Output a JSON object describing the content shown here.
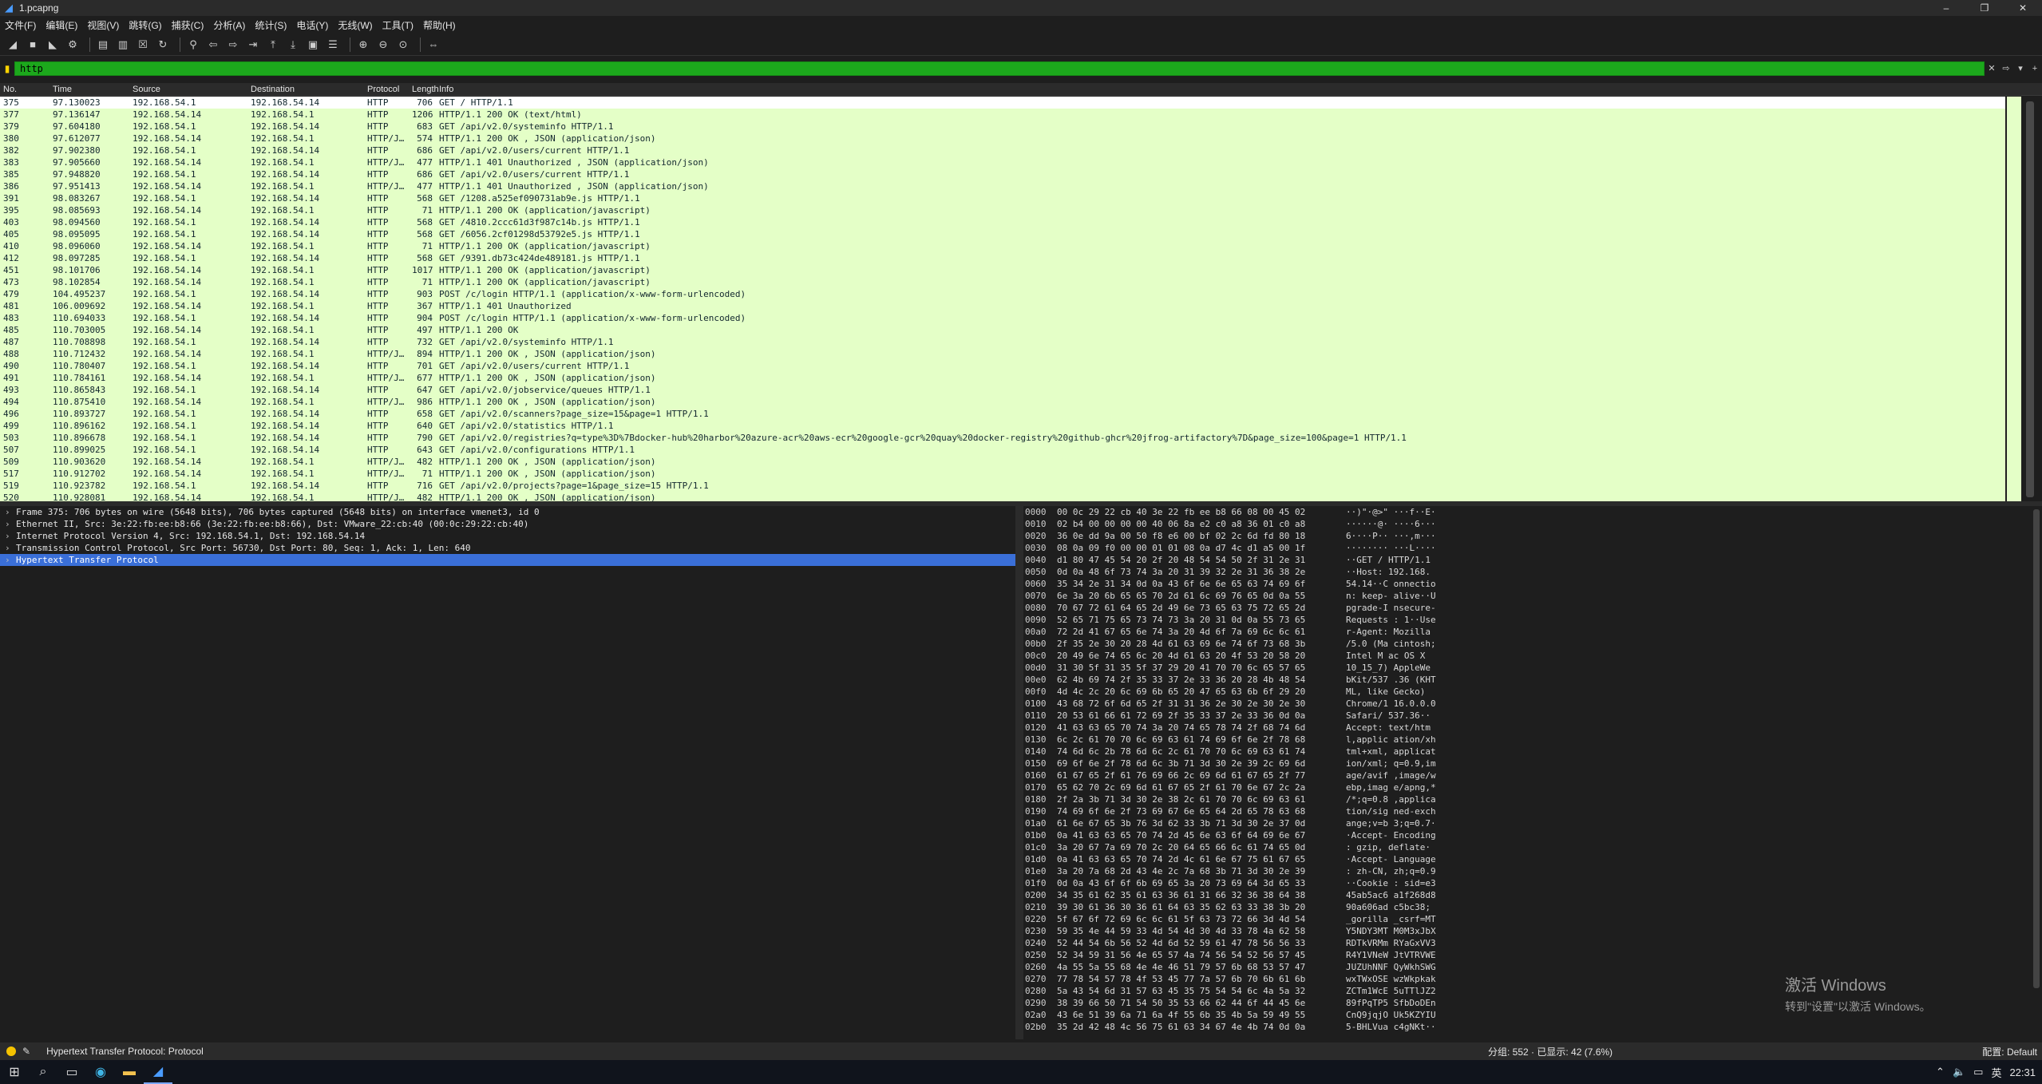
{
  "window": {
    "title": "1.pcapng",
    "minimize": "–",
    "maximize": "❐",
    "close": "✕"
  },
  "menu": [
    "文件(F)",
    "编辑(E)",
    "视图(V)",
    "跳转(G)",
    "捕获(C)",
    "分析(A)",
    "统计(S)",
    "电话(Y)",
    "无线(W)",
    "工具(T)",
    "帮助(H)"
  ],
  "toolbar_icons": [
    "shark-fin-icon",
    "stop-icon",
    "restart-icon",
    "gear-icon",
    "open-file-icon",
    "save-file-icon",
    "close-file-icon",
    "reload-icon",
    "find-icon",
    "back-icon",
    "forward-icon",
    "go-to-icon",
    "first-icon",
    "last-icon",
    "autoscroll-icon",
    "colorize-icon",
    "zoom-in-icon",
    "zoom-out-icon",
    "zoom-reset-icon",
    "resize-columns-icon"
  ],
  "filter": {
    "value": "http",
    "clear": "✕",
    "arrow": "⇨",
    "add": "+"
  },
  "columns": [
    "No.",
    "Time",
    "Source",
    "Destination",
    "Protocol",
    "Length",
    "Info"
  ],
  "packets": [
    {
      "no": "375",
      "time": "97.130023",
      "src": "192.168.54.1",
      "dst": "192.168.54.14",
      "proto": "HTTP",
      "len": "706",
      "info": "GET / HTTP/1.1",
      "sel": true
    },
    {
      "no": "377",
      "time": "97.136147",
      "src": "192.168.54.14",
      "dst": "192.168.54.1",
      "proto": "HTTP",
      "len": "1206",
      "info": "HTTP/1.1 200 OK  (text/html)"
    },
    {
      "no": "379",
      "time": "97.604180",
      "src": "192.168.54.1",
      "dst": "192.168.54.14",
      "proto": "HTTP",
      "len": "683",
      "info": "GET /api/v2.0/systeminfo HTTP/1.1"
    },
    {
      "no": "380",
      "time": "97.612077",
      "src": "192.168.54.14",
      "dst": "192.168.54.1",
      "proto": "HTTP/J…",
      "len": "574",
      "info": "HTTP/1.1 200 OK , JSON (application/json)"
    },
    {
      "no": "382",
      "time": "97.902380",
      "src": "192.168.54.1",
      "dst": "192.168.54.14",
      "proto": "HTTP",
      "len": "686",
      "info": "GET /api/v2.0/users/current HTTP/1.1"
    },
    {
      "no": "383",
      "time": "97.905660",
      "src": "192.168.54.14",
      "dst": "192.168.54.1",
      "proto": "HTTP/J…",
      "len": "477",
      "info": "HTTP/1.1 401 Unauthorized , JSON (application/json)"
    },
    {
      "no": "385",
      "time": "97.948820",
      "src": "192.168.54.1",
      "dst": "192.168.54.14",
      "proto": "HTTP",
      "len": "686",
      "info": "GET /api/v2.0/users/current HTTP/1.1"
    },
    {
      "no": "386",
      "time": "97.951413",
      "src": "192.168.54.14",
      "dst": "192.168.54.1",
      "proto": "HTTP/J…",
      "len": "477",
      "info": "HTTP/1.1 401 Unauthorized , JSON (application/json)"
    },
    {
      "no": "391",
      "time": "98.083267",
      "src": "192.168.54.1",
      "dst": "192.168.54.14",
      "proto": "HTTP",
      "len": "568",
      "info": "GET /1208.a525ef090731ab9e.js HTTP/1.1"
    },
    {
      "no": "395",
      "time": "98.085693",
      "src": "192.168.54.14",
      "dst": "192.168.54.1",
      "proto": "HTTP",
      "len": "71",
      "info": "HTTP/1.1 200 OK  (application/javascript)"
    },
    {
      "no": "403",
      "time": "98.094560",
      "src": "192.168.54.1",
      "dst": "192.168.54.14",
      "proto": "HTTP",
      "len": "568",
      "info": "GET /4810.2ccc61d3f987c14b.js HTTP/1.1"
    },
    {
      "no": "405",
      "time": "98.095095",
      "src": "192.168.54.1",
      "dst": "192.168.54.14",
      "proto": "HTTP",
      "len": "568",
      "info": "GET /6056.2cf01298d53792e5.js HTTP/1.1"
    },
    {
      "no": "410",
      "time": "98.096060",
      "src": "192.168.54.14",
      "dst": "192.168.54.1",
      "proto": "HTTP",
      "len": "71",
      "info": "HTTP/1.1 200 OK  (application/javascript)"
    },
    {
      "no": "412",
      "time": "98.097285",
      "src": "192.168.54.1",
      "dst": "192.168.54.14",
      "proto": "HTTP",
      "len": "568",
      "info": "GET /9391.db73c424de489181.js HTTP/1.1"
    },
    {
      "no": "451",
      "time": "98.101706",
      "src": "192.168.54.14",
      "dst": "192.168.54.1",
      "proto": "HTTP",
      "len": "1017",
      "info": "HTTP/1.1 200 OK  (application/javascript)"
    },
    {
      "no": "473",
      "time": "98.102854",
      "src": "192.168.54.14",
      "dst": "192.168.54.1",
      "proto": "HTTP",
      "len": "71",
      "info": "HTTP/1.1 200 OK  (application/javascript)"
    },
    {
      "no": "479",
      "time": "104.495237",
      "src": "192.168.54.1",
      "dst": "192.168.54.14",
      "proto": "HTTP",
      "len": "903",
      "info": "POST /c/login HTTP/1.1  (application/x-www-form-urlencoded)"
    },
    {
      "no": "481",
      "time": "106.009692",
      "src": "192.168.54.14",
      "dst": "192.168.54.1",
      "proto": "HTTP",
      "len": "367",
      "info": "HTTP/1.1 401 Unauthorized"
    },
    {
      "no": "483",
      "time": "110.694033",
      "src": "192.168.54.1",
      "dst": "192.168.54.14",
      "proto": "HTTP",
      "len": "904",
      "info": "POST /c/login HTTP/1.1  (application/x-www-form-urlencoded)"
    },
    {
      "no": "485",
      "time": "110.703005",
      "src": "192.168.54.14",
      "dst": "192.168.54.1",
      "proto": "HTTP",
      "len": "497",
      "info": "HTTP/1.1 200 OK"
    },
    {
      "no": "487",
      "time": "110.708898",
      "src": "192.168.54.1",
      "dst": "192.168.54.14",
      "proto": "HTTP",
      "len": "732",
      "info": "GET /api/v2.0/systeminfo HTTP/1.1"
    },
    {
      "no": "488",
      "time": "110.712432",
      "src": "192.168.54.14",
      "dst": "192.168.54.1",
      "proto": "HTTP/J…",
      "len": "894",
      "info": "HTTP/1.1 200 OK , JSON (application/json)"
    },
    {
      "no": "490",
      "time": "110.780407",
      "src": "192.168.54.1",
      "dst": "192.168.54.14",
      "proto": "HTTP",
      "len": "701",
      "info": "GET /api/v2.0/users/current HTTP/1.1"
    },
    {
      "no": "491",
      "time": "110.784161",
      "src": "192.168.54.14",
      "dst": "192.168.54.1",
      "proto": "HTTP/J…",
      "len": "677",
      "info": "HTTP/1.1 200 OK , JSON (application/json)"
    },
    {
      "no": "493",
      "time": "110.865843",
      "src": "192.168.54.1",
      "dst": "192.168.54.14",
      "proto": "HTTP",
      "len": "647",
      "info": "GET /api/v2.0/jobservice/queues HTTP/1.1"
    },
    {
      "no": "494",
      "time": "110.875410",
      "src": "192.168.54.14",
      "dst": "192.168.54.1",
      "proto": "HTTP/J…",
      "len": "986",
      "info": "HTTP/1.1 200 OK , JSON (application/json)"
    },
    {
      "no": "496",
      "time": "110.893727",
      "src": "192.168.54.1",
      "dst": "192.168.54.14",
      "proto": "HTTP",
      "len": "658",
      "info": "GET /api/v2.0/scanners?page_size=15&page=1 HTTP/1.1"
    },
    {
      "no": "499",
      "time": "110.896162",
      "src": "192.168.54.1",
      "dst": "192.168.54.14",
      "proto": "HTTP",
      "len": "640",
      "info": "GET /api/v2.0/statistics HTTP/1.1"
    },
    {
      "no": "503",
      "time": "110.896678",
      "src": "192.168.54.1",
      "dst": "192.168.54.14",
      "proto": "HTTP",
      "len": "790",
      "info": "GET /api/v2.0/registries?q=type%3D%7Bdocker-hub%20harbor%20azure-acr%20aws-ecr%20google-gcr%20quay%20docker-registry%20github-ghcr%20jfrog-artifactory%7D&page_size=100&page=1 HTTP/1.1"
    },
    {
      "no": "507",
      "time": "110.899025",
      "src": "192.168.54.1",
      "dst": "192.168.54.14",
      "proto": "HTTP",
      "len": "643",
      "info": "GET /api/v2.0/configurations HTTP/1.1"
    },
    {
      "no": "509",
      "time": "110.903620",
      "src": "192.168.54.14",
      "dst": "192.168.54.1",
      "proto": "HTTP/J…",
      "len": "482",
      "info": "HTTP/1.1 200 OK , JSON (application/json)"
    },
    {
      "no": "517",
      "time": "110.912702",
      "src": "192.168.54.14",
      "dst": "192.168.54.1",
      "proto": "HTTP/J…",
      "len": "71",
      "info": "HTTP/1.1 200 OK , JSON (application/json)"
    },
    {
      "no": "519",
      "time": "110.923782",
      "src": "192.168.54.1",
      "dst": "192.168.54.14",
      "proto": "HTTP",
      "len": "716",
      "info": "GET /api/v2.0/projects?page=1&page_size=15 HTTP/1.1"
    },
    {
      "no": "520",
      "time": "110.928081",
      "src": "192.168.54.14",
      "dst": "192.168.54.1",
      "proto": "HTTP/J…",
      "len": "482",
      "info": "HTTP/1.1 200 OK , JSON (application/json)"
    }
  ],
  "details": [
    {
      "text": "Frame 375: 706 bytes on wire (5648 bits), 706 bytes captured (5648 bits) on interface vmenet3, id 0"
    },
    {
      "text": "Ethernet II, Src: 3e:22:fb:ee:b8:66 (3e:22:fb:ee:b8:66), Dst: VMware_22:cb:40 (00:0c:29:22:cb:40)"
    },
    {
      "text": "Internet Protocol Version 4, Src: 192.168.54.1, Dst: 192.168.54.14"
    },
    {
      "text": "Transmission Control Protocol, Src Port: 56730, Dst Port: 80, Seq: 1, Ack: 1, Len: 640"
    },
    {
      "text": "Hypertext Transfer Protocol",
      "sel": true
    }
  ],
  "bytes": [
    [
      "0000",
      "00 0c 29 22 cb 40 3e 22  fb ee b8 66 08 00 45 02",
      "··)\"·@>\"  ···f··E·"
    ],
    [
      "0010",
      "02 b4 00 00 00 00 40 06  8a e2 c0 a8 36 01 c0 a8",
      "······@·  ····6···"
    ],
    [
      "0020",
      "36 0e dd 9a 00 50 f8 e6  00 bf 02 2c 6d fd 80 18",
      "6····P··  ···,m···"
    ],
    [
      "0030",
      "08 0a 09 f0 00 00 01 01  08 0a d7 4c d1 a5 00 1f",
      "········  ···L····"
    ],
    [
      "0040",
      "d1 80 47 45 54 20 2f 20  48 54 54 50 2f 31 2e 31",
      "··GET /   HTTP/1.1"
    ],
    [
      "0050",
      "0d 0a 48 6f 73 74 3a 20  31 39 32 2e 31 36 38 2e",
      "··Host:   192.168."
    ],
    [
      "0060",
      "35 34 2e 31 34 0d 0a 43  6f 6e 6e 65 63 74 69 6f",
      "54.14··C  onnectio"
    ],
    [
      "0070",
      "6e 3a 20 6b 65 65 70 2d  61 6c 69 76 65 0d 0a 55",
      "n: keep-  alive··U"
    ],
    [
      "0080",
      "70 67 72 61 64 65 2d 49  6e 73 65 63 75 72 65 2d",
      "pgrade-I  nsecure-"
    ],
    [
      "0090",
      "52 65 71 75 65 73 74 73  3a 20 31 0d 0a 55 73 65",
      "Requests  : 1··Use"
    ],
    [
      "00a0",
      "72 2d 41 67 65 6e 74 3a  20 4d 6f 7a 69 6c 6c 61",
      "r-Agent:   Mozilla"
    ],
    [
      "00b0",
      "2f 35 2e 30 20 28 4d 61  63 69 6e 74 6f 73 68 3b",
      "/5.0 (Ma  cintosh;"
    ],
    [
      "00c0",
      "20 49 6e 74 65 6c 20 4d  61 63 20 4f 53 20 58 20",
      " Intel M  ac OS X "
    ],
    [
      "00d0",
      "31 30 5f 31 35 5f 37 29  20 41 70 70 6c 65 57 65",
      "10_15_7)   AppleWe"
    ],
    [
      "00e0",
      "62 4b 69 74 2f 35 33 37  2e 33 36 20 28 4b 48 54",
      "bKit/537  .36 (KHT"
    ],
    [
      "00f0",
      "4d 4c 2c 20 6c 69 6b 65  20 47 65 63 6b 6f 29 20",
      "ML, like   Gecko) "
    ],
    [
      "0100",
      "43 68 72 6f 6d 65 2f 31  31 36 2e 30 2e 30 2e 30",
      "Chrome/1  16.0.0.0"
    ],
    [
      "0110",
      "20 53 61 66 61 72 69 2f  35 33 37 2e 33 36 0d 0a",
      " Safari/  537.36··"
    ],
    [
      "0120",
      "41 63 63 65 70 74 3a 20  74 65 78 74 2f 68 74 6d",
      "Accept:   text/htm"
    ],
    [
      "0130",
      "6c 2c 61 70 70 6c 69 63  61 74 69 6f 6e 2f 78 68",
      "l,applic  ation/xh"
    ],
    [
      "0140",
      "74 6d 6c 2b 78 6d 6c 2c  61 70 70 6c 69 63 61 74",
      "tml+xml,  applicat"
    ],
    [
      "0150",
      "69 6f 6e 2f 78 6d 6c 3b  71 3d 30 2e 39 2c 69 6d",
      "ion/xml;  q=0.9,im"
    ],
    [
      "0160",
      "61 67 65 2f 61 76 69 66  2c 69 6d 61 67 65 2f 77",
      "age/avif  ,image/w"
    ],
    [
      "0170",
      "65 62 70 2c 69 6d 61 67  65 2f 61 70 6e 67 2c 2a",
      "ebp,imag  e/apng,*"
    ],
    [
      "0180",
      "2f 2a 3b 71 3d 30 2e 38  2c 61 70 70 6c 69 63 61",
      "/*;q=0.8  ,applica"
    ],
    [
      "0190",
      "74 69 6f 6e 2f 73 69 67  6e 65 64 2d 65 78 63 68",
      "tion/sig  ned-exch"
    ],
    [
      "01a0",
      "61 6e 67 65 3b 76 3d 62  33 3b 71 3d 30 2e 37 0d",
      "ange;v=b  3;q=0.7·"
    ],
    [
      "01b0",
      "0a 41 63 63 65 70 74 2d  45 6e 63 6f 64 69 6e 67",
      "·Accept-  Encoding"
    ],
    [
      "01c0",
      "3a 20 67 7a 69 70 2c 20  64 65 66 6c 61 74 65 0d",
      ": gzip,   deflate·"
    ],
    [
      "01d0",
      "0a 41 63 63 65 70 74 2d  4c 61 6e 67 75 61 67 65",
      "·Accept-  Language"
    ],
    [
      "01e0",
      "3a 20 7a 68 2d 43 4e 2c  7a 68 3b 71 3d 30 2e 39",
      ": zh-CN,  zh;q=0.9"
    ],
    [
      "01f0",
      "0d 0a 43 6f 6f 6b 69 65  3a 20 73 69 64 3d 65 33",
      "··Cookie  : sid=e3"
    ],
    [
      "0200",
      "34 35 61 62 35 61 63 36  61 31 66 32 36 38 64 38",
      "45ab5ac6  a1f268d8"
    ],
    [
      "0210",
      "39 30 61 36 30 36 61 64  63 35 62 63 33 38 3b 20",
      "90a606ad  c5bc38; "
    ],
    [
      "0220",
      "5f 67 6f 72 69 6c 6c 61  5f 63 73 72 66 3d 4d 54",
      "_gorilla  _csrf=MT"
    ],
    [
      "0230",
      "59 35 4e 44 59 33 4d 54  4d 30 4d 33 78 4a 62 58",
      "Y5NDY3MT  M0M3xJbX"
    ],
    [
      "0240",
      "52 44 54 6b 56 52 4d 6d  52 59 61 47 78 56 56 33",
      "RDTkVRMm  RYaGxVV3"
    ],
    [
      "0250",
      "52 34 59 31 56 4e 65 57  4a 74 56 54 52 56 57 45",
      "R4Y1VNeW  JtVTRVWE"
    ],
    [
      "0260",
      "4a 55 5a 55 68 4e 4e 46  51 79 57 6b 68 53 57 47",
      "JUZUhNNF  QyWkhSWG"
    ],
    [
      "0270",
      "77 78 54 57 78 4f 53 45  77 7a 57 6b 70 6b 61 6b",
      "wxTWxOSE  wzWkpkak"
    ],
    [
      "0280",
      "5a 43 54 6d 31 57 63 45  35 75 54 54 6c 4a 5a 32",
      "ZCTm1WcE  5uTTlJZ2"
    ],
    [
      "0290",
      "38 39 66 50 71 54 50 35  53 66 62 44 6f 44 45 6e",
      "89fPqTP5  SfbDoDEn"
    ],
    [
      "02a0",
      "43 6e 51 39 6a 71 6a 4f  55 6b 35 4b 5a 59 49 55",
      "CnQ9jqjO  Uk5KZYIU"
    ],
    [
      "02b0",
      "35 2d 42 48 4c 56 75 61  63 34 67 4e 4b 74 0d 0a",
      "5-BHLVua  c4gNKt··"
    ]
  ],
  "watermark": {
    "line1": "激活 Windows",
    "line2": "转到\"设置\"以激活 Windows。"
  },
  "status": {
    "text": "Hypertext Transfer Protocol: Protocol",
    "right": "分组: 552 · 已显示: 42 (7.6%)",
    "profile": "配置: Default"
  },
  "taskbar": {
    "time": "22:31",
    "ime": "英"
  },
  "colors": {
    "http_row_bg": "#e4ffc7",
    "filter_ok": "#1ca81c",
    "selected_detail": "#3a6fd8"
  }
}
